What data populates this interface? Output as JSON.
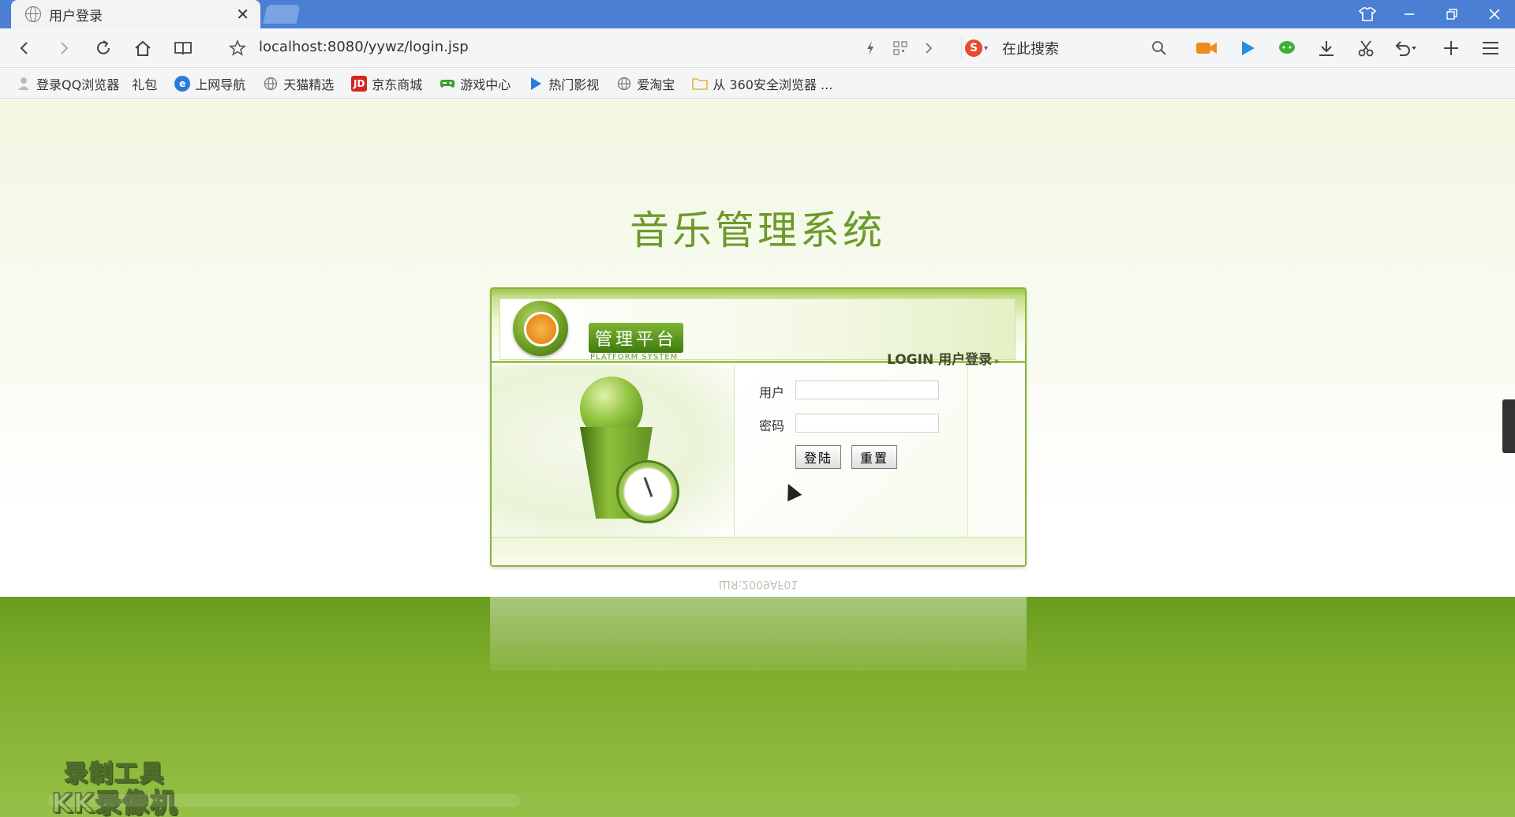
{
  "browser": {
    "tab_title": "用户登录",
    "address": "localhost:8080/yywz/login.jsp",
    "search_placeholder": "在此搜索"
  },
  "bookmarks": [
    {
      "label": "登录QQ浏览器",
      "icon": "user-icon"
    },
    {
      "label": "礼包",
      "icon": ""
    },
    {
      "label": "上网导航",
      "icon": "ie-icon",
      "color": "#2a7bd6"
    },
    {
      "label": "天猫精选",
      "icon": "globe-icon"
    },
    {
      "label": "京东商城",
      "icon": "jd-icon",
      "color": "#d3281f"
    },
    {
      "label": "游戏中心",
      "icon": "gamepad-icon",
      "color": "#3aa22b"
    },
    {
      "label": "热门影视",
      "icon": "play-icon",
      "color": "#2a7bd6"
    },
    {
      "label": "爱淘宝",
      "icon": "globe-icon"
    },
    {
      "label": "从 360安全浏览器 ...",
      "icon": "folder-icon",
      "color": "#e7b936"
    }
  ],
  "page": {
    "system_title": "音乐管理系统",
    "platform_badge": "管理平台",
    "platform_subtitle": "PLATFORM SYSTEM",
    "login_tag": "LOGIN 用户登录",
    "username_label": "用户",
    "username_value": "",
    "password_label": "密码",
    "password_value": "",
    "login_button": "登陆",
    "reset_button": "重置",
    "reflection_text": "ШЯ:2009AF01"
  },
  "watermark": {
    "line1": "录制工具",
    "line2": "KK录像机"
  },
  "colors": {
    "titlebar": "#4a7fd4",
    "accent_green": "#6c9a2a",
    "bottom_green": "#7fae2c"
  }
}
